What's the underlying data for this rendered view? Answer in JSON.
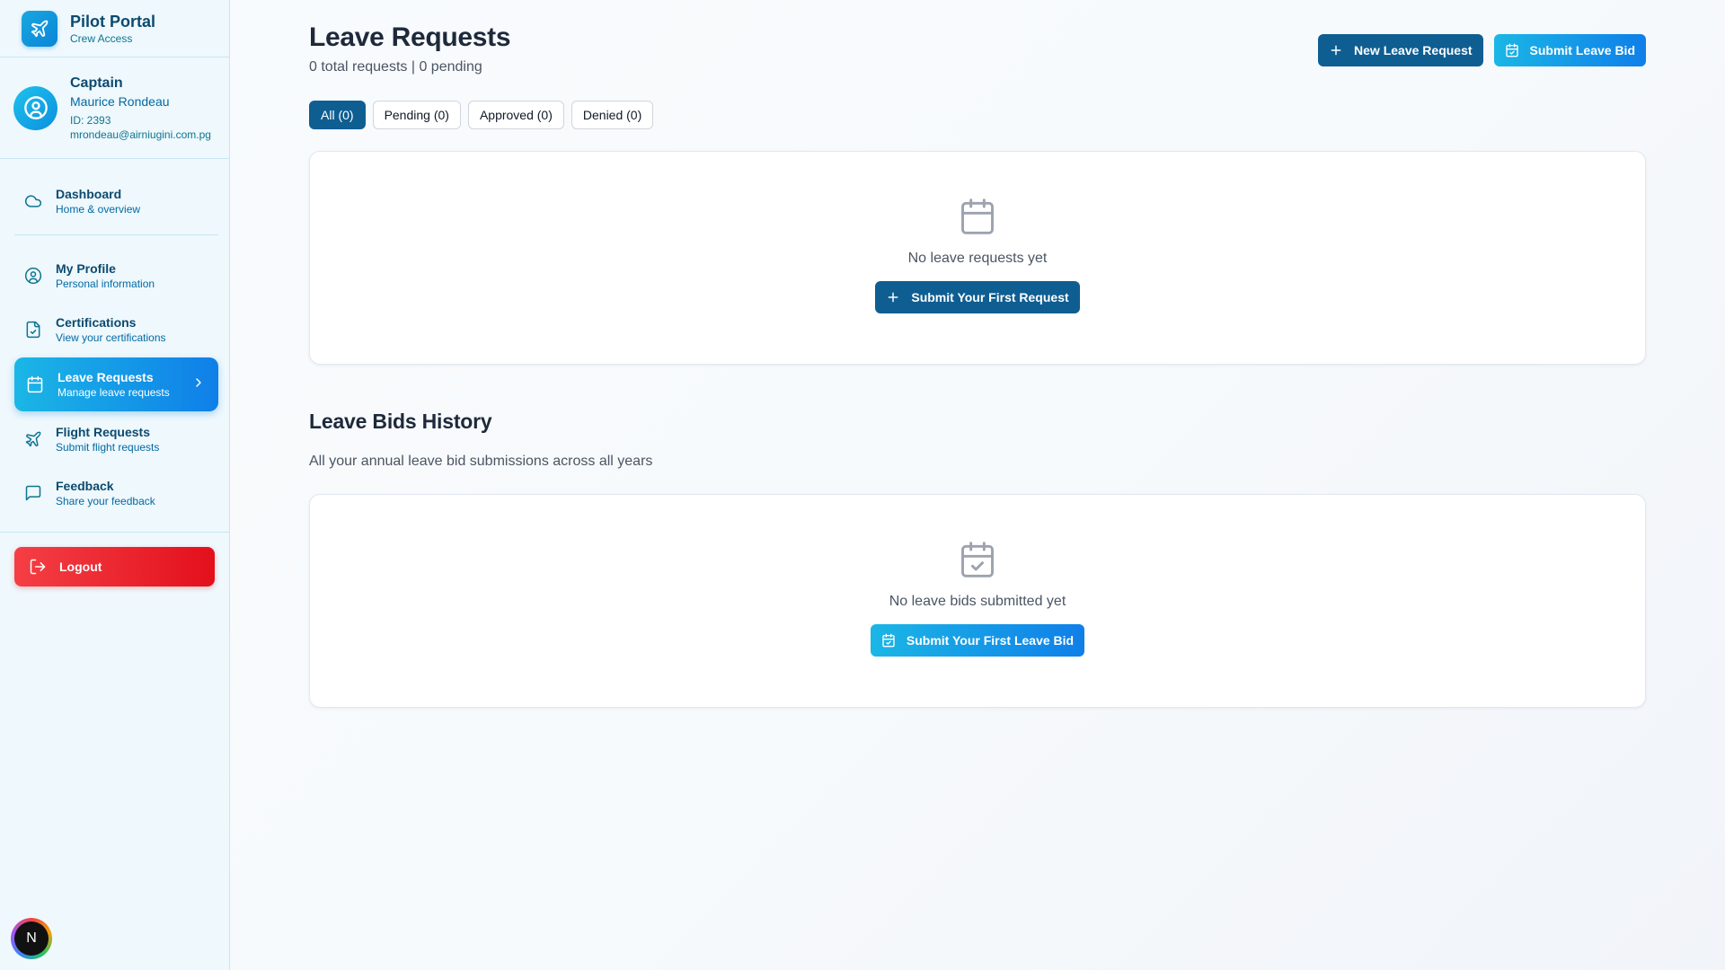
{
  "brand": {
    "title": "Pilot Portal",
    "subtitle": "Crew Access"
  },
  "user": {
    "rank": "Captain",
    "name": "Maurice Rondeau",
    "id_line": "ID: 2393",
    "email": "mrondeau@airniugini.com.pg"
  },
  "nav": {
    "items": [
      {
        "label": "Dashboard",
        "sub": "Home & overview",
        "icon": "cloud-icon"
      },
      {
        "label": "My Profile",
        "sub": "Personal information",
        "icon": "user-circle-icon"
      },
      {
        "label": "Certifications",
        "sub": "View your certifications",
        "icon": "file-check-icon"
      },
      {
        "label": "Leave Requests",
        "sub": "Manage leave requests",
        "icon": "calendar-icon",
        "active": true
      },
      {
        "label": "Flight Requests",
        "sub": "Submit flight requests",
        "icon": "plane-icon"
      },
      {
        "label": "Feedback",
        "sub": "Share your feedback",
        "icon": "message-square-icon"
      }
    ],
    "logout": "Logout"
  },
  "badge": {
    "letter": "N"
  },
  "header": {
    "title": "Leave Requests",
    "subtitle": "0 total requests | 0 pending",
    "new_request": "New Leave Request",
    "submit_bid": "Submit Leave Bid"
  },
  "filters": [
    "All (0)",
    "Pending (0)",
    "Approved (0)",
    "Denied (0)"
  ],
  "requests_panel": {
    "empty_text": "No leave requests yet",
    "button": "Submit Your First Request"
  },
  "bids": {
    "title": "Leave Bids History",
    "subtitle": "All your annual leave bid submissions across all years",
    "empty_text": "No leave bids submitted yet",
    "button": "Submit Your First Leave Bid"
  },
  "colors": {
    "primary_dark": "#0f5e92",
    "accent_gradient_start": "#1bb6e6",
    "accent_gradient_end": "#0f7fe8",
    "logout_red": "#e3101c"
  }
}
